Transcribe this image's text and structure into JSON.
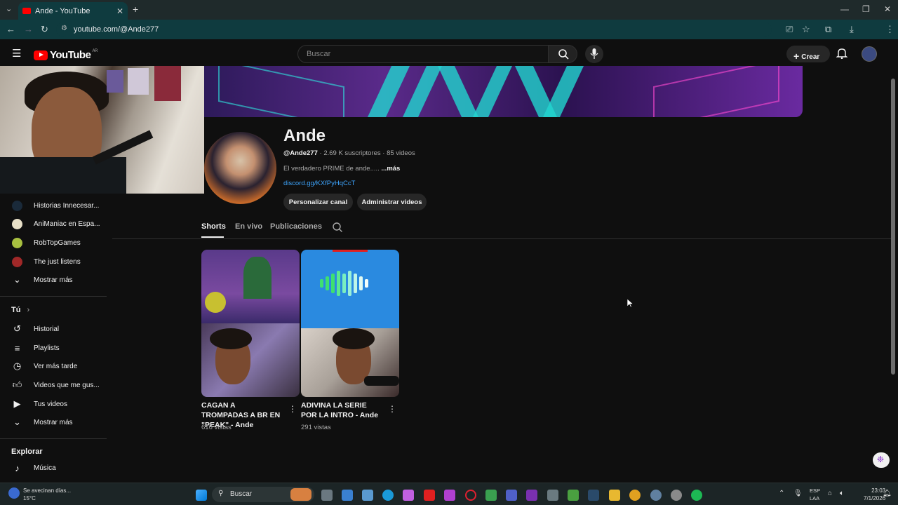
{
  "browser": {
    "tab_title": "Ande - YouTube",
    "tab_close": "✕",
    "new_tab": "+",
    "url": "youtube.com/@Ande277"
  },
  "header": {
    "logo_text": "YouTube",
    "logo_region": "AR",
    "search_placeholder": "Buscar",
    "create_label": "Crear"
  },
  "sidebar": {
    "subscriptions": [
      {
        "label": "Historias Innecesar..."
      },
      {
        "label": "AniManiac en Espa..."
      },
      {
        "label": "RobTopGames"
      },
      {
        "label": "The just listens"
      }
    ],
    "show_more_1": "Mostrar más",
    "you_heading": "Tú",
    "you_items": [
      {
        "label": "Historial"
      },
      {
        "label": "Playlists"
      },
      {
        "label": "Ver más tarde"
      },
      {
        "label": "Videos que me gus..."
      },
      {
        "label": "Tus videos"
      }
    ],
    "show_more_2": "Mostrar más",
    "explore_heading": "Explorar",
    "explore_items": [
      {
        "label": "Música"
      }
    ]
  },
  "channel": {
    "name": "Ande",
    "handle": "@Ande277",
    "stats": " · 2.69 K suscriptores · 85 videos",
    "description": "El verdadero PRIME de ande..... ",
    "more": "...más",
    "link": "discord.gg/KXfPyHqCcT",
    "customize_button": "Personalizar canal",
    "manage_button": "Administrar videos"
  },
  "tabs": [
    {
      "label": "Shorts"
    },
    {
      "label": "En vivo"
    },
    {
      "label": "Publicaciones"
    }
  ],
  "shorts": [
    {
      "title": "CAGAN A TROMPADAS A BR EN \"PEAK\" - Ande",
      "views": "616 vistas"
    },
    {
      "title": "ADIVINA LA SERIE POR LA INTRO - Ande",
      "views": "291 vistas"
    }
  ],
  "taskbar": {
    "weather_text": "Se avecinan días...",
    "weather_temp": "15°C",
    "search_label": "Buscar",
    "lang_line1": "ESP",
    "lang_line2": "LAA",
    "time": "23:03",
    "date": "7/1/2026"
  },
  "colors": {
    "background": "#0f0f0f",
    "youtube_red": "#ff0000",
    "link_blue": "#3ea6ff",
    "browser_teal": "#0f3b3f"
  }
}
